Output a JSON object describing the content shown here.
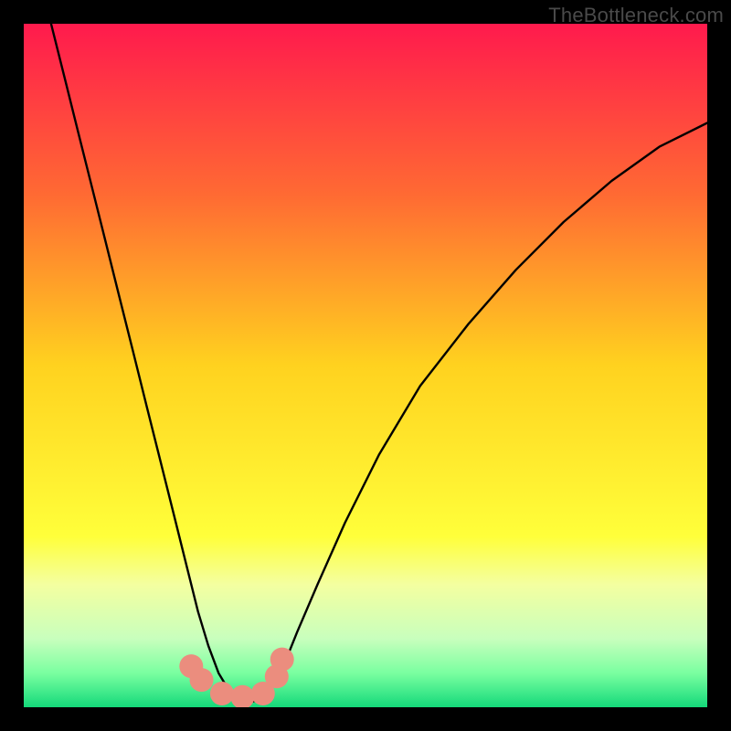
{
  "watermark": "TheBottleneck.com",
  "chart_data": {
    "type": "line",
    "title": "",
    "xlabel": "",
    "ylabel": "",
    "xlim": [
      0,
      1
    ],
    "ylim": [
      0,
      1
    ],
    "background_gradient": {
      "stops": [
        {
          "offset": 0.0,
          "color": "#ff1a4d"
        },
        {
          "offset": 0.25,
          "color": "#ff6a33"
        },
        {
          "offset": 0.5,
          "color": "#ffd21f"
        },
        {
          "offset": 0.75,
          "color": "#ffff3a"
        },
        {
          "offset": 0.82,
          "color": "#f4ffa0"
        },
        {
          "offset": 0.9,
          "color": "#c8ffbd"
        },
        {
          "offset": 0.95,
          "color": "#7affa0"
        },
        {
          "offset": 1.0,
          "color": "#14d97a"
        }
      ]
    },
    "series": [
      {
        "name": "bottleneck-curve",
        "color": "#000000",
        "width": 2.4,
        "x": [
          0.04,
          0.06,
          0.08,
          0.1,
          0.12,
          0.14,
          0.16,
          0.18,
          0.2,
          0.22,
          0.24,
          0.255,
          0.27,
          0.285,
          0.3,
          0.315,
          0.325,
          0.34,
          0.36,
          0.38,
          0.4,
          0.43,
          0.47,
          0.52,
          0.58,
          0.65,
          0.72,
          0.79,
          0.86,
          0.93,
          1.0
        ],
        "y": [
          1.0,
          0.92,
          0.84,
          0.76,
          0.68,
          0.6,
          0.52,
          0.44,
          0.36,
          0.28,
          0.2,
          0.14,
          0.09,
          0.05,
          0.025,
          0.01,
          0.005,
          0.01,
          0.025,
          0.06,
          0.11,
          0.18,
          0.27,
          0.37,
          0.47,
          0.56,
          0.64,
          0.71,
          0.77,
          0.82,
          0.855
        ]
      }
    ],
    "markers": {
      "name": "highlighted-points",
      "color": "#eb8d7e",
      "radius": 13,
      "x": [
        0.245,
        0.26,
        0.29,
        0.32,
        0.35,
        0.37,
        0.378
      ],
      "y": [
        0.06,
        0.04,
        0.02,
        0.015,
        0.02,
        0.045,
        0.07
      ]
    }
  }
}
